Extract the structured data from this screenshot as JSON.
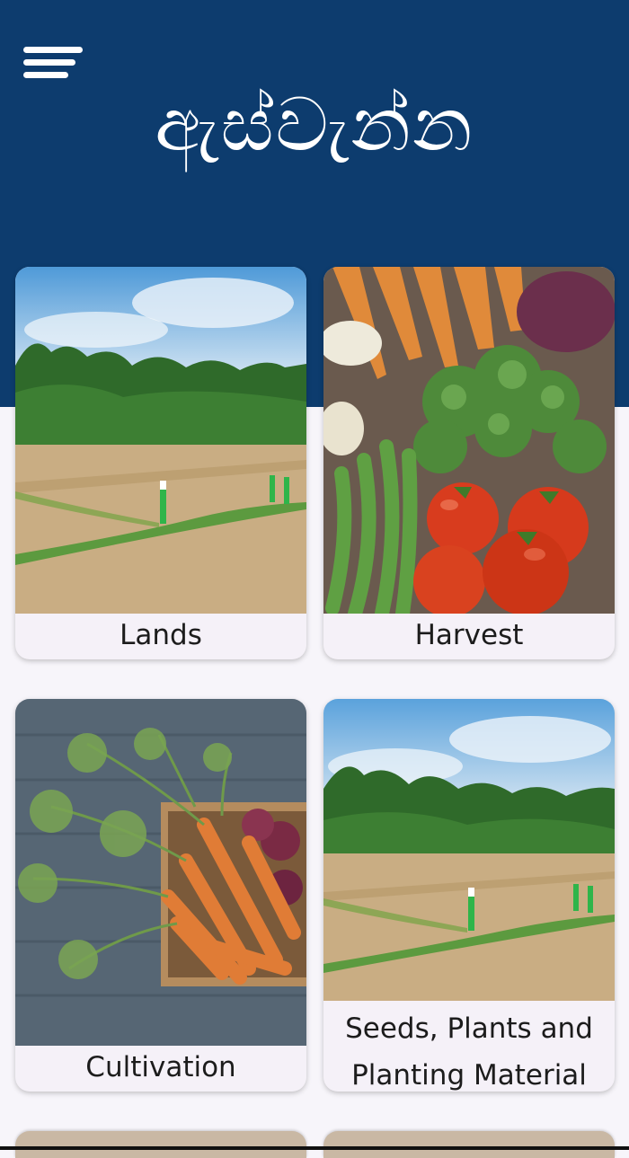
{
  "app": {
    "title": "ඇස්වැන්න",
    "menu_icon": "hamburger-menu-icon"
  },
  "colors": {
    "header": "#0d3c6e",
    "background": "#f7f5fa",
    "card": "#f5f1f8"
  },
  "cards": [
    {
      "label": "Lands",
      "image": "farmland-plots-photo"
    },
    {
      "label": "Harvest",
      "image": "harvest-vegetables-photo"
    },
    {
      "label": "Cultivation",
      "image": "carrots-in-crate-photo"
    },
    {
      "label": "Seeds, Plants and Planting Material",
      "image": "farmland-plots-photo"
    }
  ]
}
